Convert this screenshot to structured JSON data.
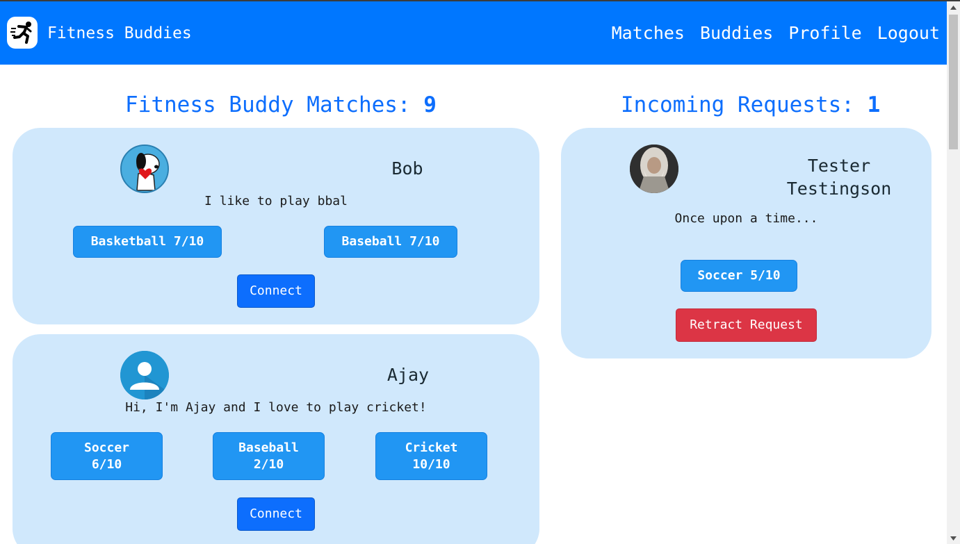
{
  "app": {
    "title": "Fitness Buddies"
  },
  "nav": {
    "items": [
      "Matches",
      "Buddies",
      "Profile",
      "Logout"
    ]
  },
  "matches": {
    "title_label": "Fitness Buddy Matches:",
    "count": "9",
    "cards": [
      {
        "name": "Bob",
        "bio": "I like to play bbal",
        "sports": [
          "Basketball 7/10",
          "Baseball 7/10"
        ],
        "connect_label": "Connect"
      },
      {
        "name": "Ajay",
        "bio": "Hi, I'm Ajay and I love to play cricket!",
        "sports": [
          {
            "name": "Soccer",
            "rating": "6/10"
          },
          {
            "name": "Baseball",
            "rating": "2/10"
          },
          {
            "name": "Cricket",
            "rating": "10/10"
          }
        ],
        "connect_label": "Connect"
      }
    ]
  },
  "requests": {
    "title_label": "Incoming Requests:",
    "count": "1",
    "cards": [
      {
        "name_line1": "Tester",
        "name_line2": "Testingson",
        "bio": "Once upon a time...",
        "sports": [
          "Soccer 5/10"
        ],
        "action_label": "Retract Request"
      }
    ]
  },
  "colors": {
    "navbar": "#0077ff",
    "card_bg": "#d0e8fc",
    "sport_badge": "#2196f3",
    "connect": "#0d6efd",
    "retract": "#dc3545",
    "title": "#0d6efd"
  },
  "icons": {
    "logo": "running-person-icon",
    "default_avatar": "user-avatar-icon"
  }
}
